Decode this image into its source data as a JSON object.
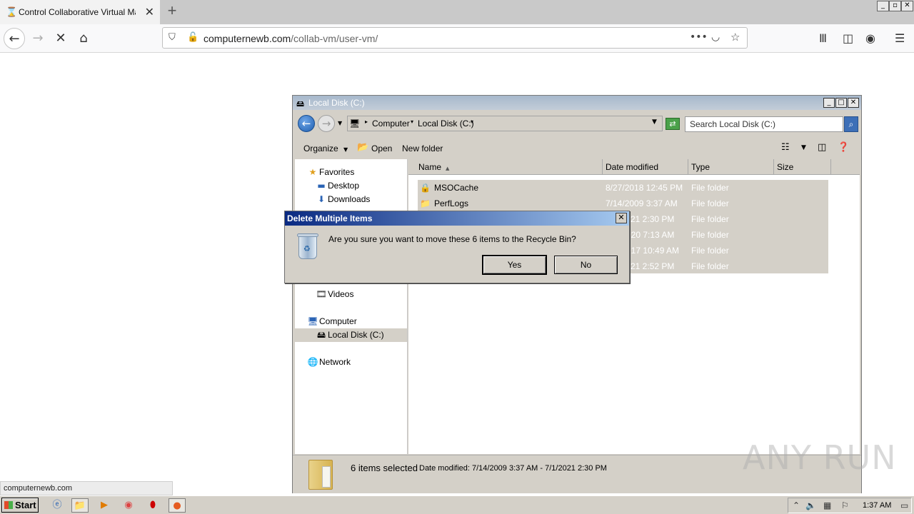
{
  "browser": {
    "tab_title": "Control Collaborative Virtual Machine",
    "new_tab_label": "+",
    "window_controls": [
      "_",
      "▫",
      "✕"
    ],
    "url_domain": "computernewb.com",
    "url_path": "/collab-vm/user-vm/",
    "status_url": "computernewb.com"
  },
  "explorer": {
    "title": "Local Disk (C:)",
    "breadcrumbs": [
      "Computer",
      "Local Disk (C:)"
    ],
    "search_placeholder": "Search Local Disk (C:)",
    "commands": {
      "organize": "Organize",
      "open": "Open",
      "new_folder": "New folder"
    },
    "nav": {
      "favorites": "Favorites",
      "desktop": "Desktop",
      "downloads": "Downloads",
      "videos": "Videos",
      "computer": "Computer",
      "local_disk": "Local Disk (C:)",
      "network": "Network"
    },
    "columns": {
      "name": "Name",
      "date": "Date modified",
      "type": "Type",
      "size": "Size"
    },
    "files": [
      {
        "name": "MSOCache",
        "date": "8/27/2018 12:45 PM",
        "type": "File folder"
      },
      {
        "name": "PerfLogs",
        "date": "7/14/2009 3:37 AM",
        "type": "File folder"
      },
      {
        "name": "",
        "date": "21 2:30 PM",
        "type": "File folder"
      },
      {
        "name": "",
        "date": "020 7:13 AM",
        "type": "File folder"
      },
      {
        "name": "",
        "date": "017 10:49 AM",
        "type": "File folder"
      },
      {
        "name": "",
        "date": "21 2:52 PM",
        "type": "File folder"
      }
    ],
    "status": {
      "count": "6 items selected",
      "date_range": "Date modified: 7/14/2009 3:37 AM - 7/1/2021 2:30 PM"
    }
  },
  "dialog": {
    "title": "Delete Multiple Items",
    "message": "Are you sure you want to move these 6 items to the Recycle Bin?",
    "yes": "Yes",
    "no": "No"
  },
  "taskbar": {
    "start": "Start",
    "clock": "1:37 AM"
  },
  "watermark": "ANY RUN"
}
